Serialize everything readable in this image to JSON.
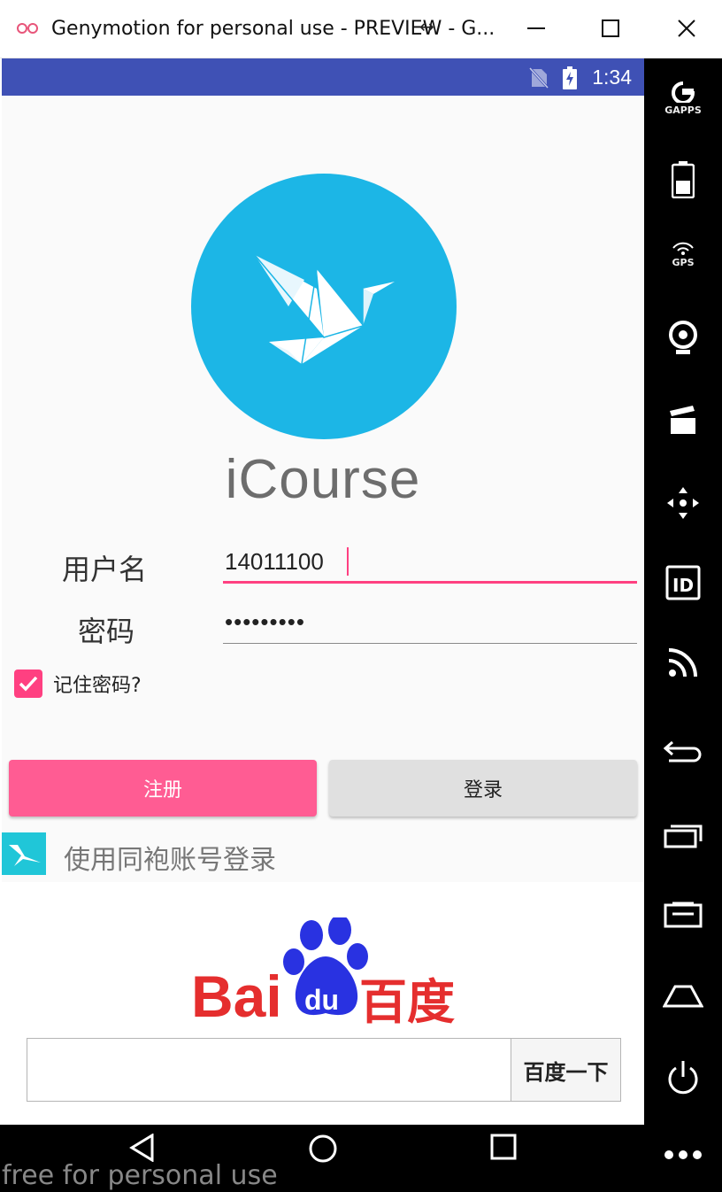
{
  "window": {
    "title": "Genymotion for personal use - PREVIEW - G..."
  },
  "statusbar": {
    "time": "1:34"
  },
  "app": {
    "title": "iCourse",
    "username_label": "用户名",
    "username_value": "14011100",
    "password_label": "密码",
    "password_value": "•••••••••",
    "remember_label": "记住密码?",
    "remember_checked": true,
    "register_label": "注册",
    "login_label": "登录",
    "sso_label": "使用同袍账号登录"
  },
  "web": {
    "baidu_logo_text_latin": "Bai",
    "baidu_logo_text_paw": "du",
    "baidu_logo_text_cn": "百度",
    "search_value": "",
    "search_button_label": "百度一下"
  },
  "sidebar": {
    "gapps_label": "GAPPS",
    "gps_label": "GPS",
    "id_label": "ID"
  },
  "watermark": "free for personal use",
  "colors": {
    "statusbar": "#3f51b5",
    "accent": "#ff4081",
    "register_button": "#ff5c93",
    "logo_circle": "#1cb6e6",
    "sso_icon": "#20c6d8",
    "baidu_red": "#e52e2e",
    "baidu_blue": "#2932e1"
  }
}
